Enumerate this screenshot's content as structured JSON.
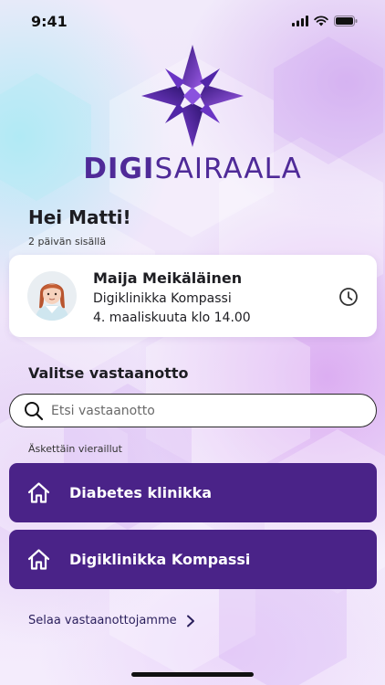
{
  "status_bar": {
    "time": "9:41"
  },
  "logo": {
    "text_bold": "DIGI",
    "text_light": "SAIRAALA"
  },
  "greeting": "Hei Matti!",
  "upcoming": {
    "label": "2 päivän sisällä",
    "name": "Maija Meikäläinen",
    "clinic": "Digiklinikka Kompassi",
    "datetime": "4. maaliskuuta klo 14.00"
  },
  "select_section": {
    "title": "Valitse vastaanotto",
    "search_placeholder": "Etsi vastaanotto"
  },
  "recent": {
    "label": "Äskettäin vieraillut",
    "items": [
      {
        "label": "Diabetes klinikka"
      },
      {
        "label": "Digiklinikka Kompassi"
      }
    ]
  },
  "browse_link": "Selaa vastaanottojamme",
  "colors": {
    "brand_purple": "#4a2388",
    "logo_text": "#4f2a98",
    "accent_violet": "#8a4fd8"
  },
  "icons": [
    "signal-icon",
    "wifi-icon",
    "battery-icon",
    "clock-icon",
    "search-icon",
    "home-icon",
    "chevron-right-icon"
  ]
}
